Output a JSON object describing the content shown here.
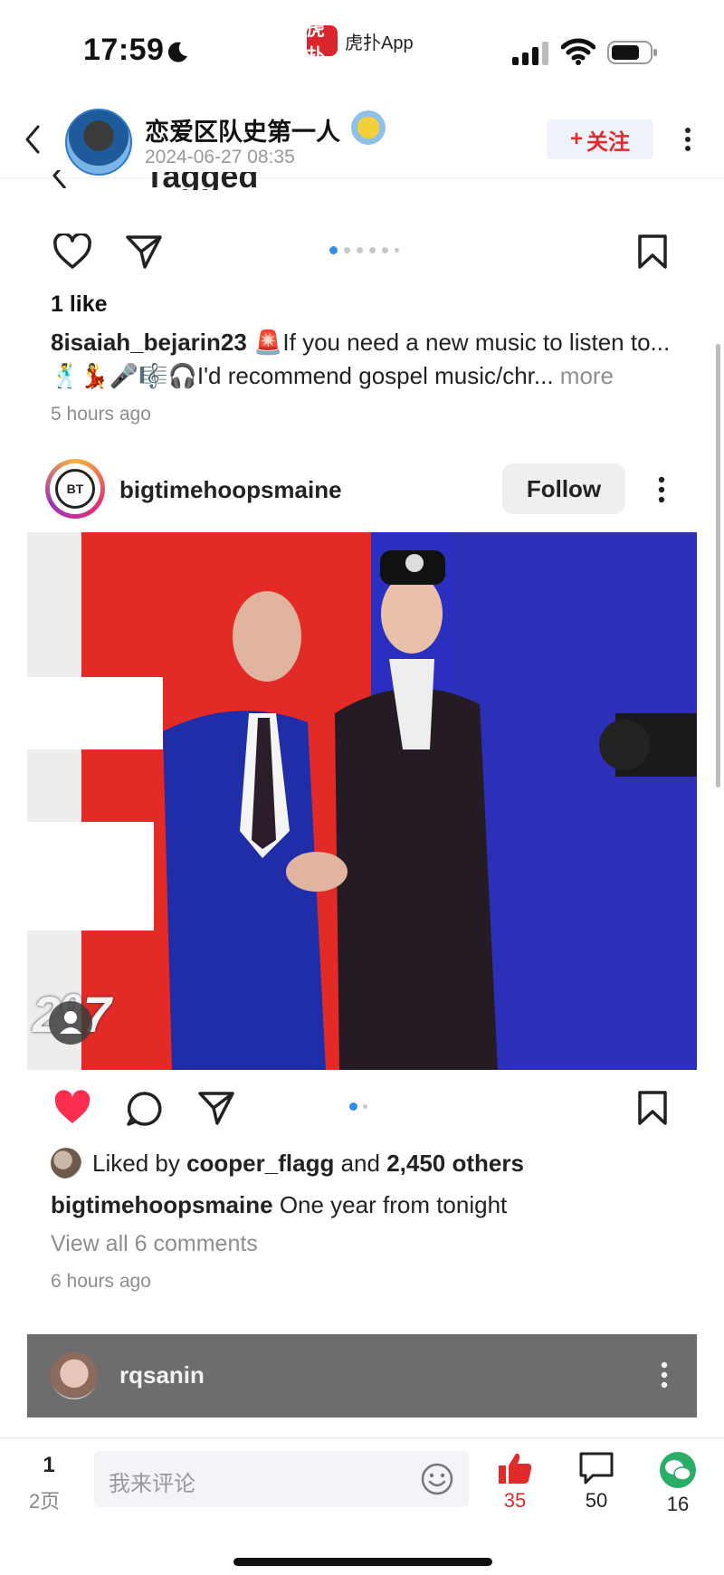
{
  "status_bar": {
    "time": "17:59",
    "app_name": "虎扑App",
    "app_logo_text": "虎扑"
  },
  "header": {
    "title": "恋爱区队史第一人",
    "date": "2024-06-27 08:35",
    "follow_label": "关注"
  },
  "embedded": {
    "tagged_title": "Tagged",
    "post1": {
      "likes": "1 like",
      "username": "8isaiah_bejarin23",
      "caption_text": "🚨If you need a new music to listen to...🕺💃🎤🎼🎧I'd recommend gospel music/chr...",
      "more_label": "more",
      "time": "5 hours ago"
    },
    "post2": {
      "username": "bigtimehoopsmaine",
      "avatar_text": "BT",
      "follow_label": "Follow",
      "photo_logo": "2⁰7",
      "liked_by_prefix": "Liked by",
      "liked_by_user": "cooper_flagg",
      "liked_by_and": "and",
      "liked_by_count": "2,450 others",
      "caption_user": "bigtimehoopsmaine",
      "caption_text": "One year from tonight",
      "view_comments": "View all 6 comments",
      "time": "6 hours ago"
    },
    "post3": {
      "username": "rqsanin"
    }
  },
  "bottom_bar": {
    "page_current": "1",
    "page_total": "2页",
    "comment_placeholder": "我来评论",
    "likes": "35",
    "comments": "50",
    "shares": "16"
  },
  "colors": {
    "accent_red": "#e02b2b",
    "instagram_blue": "#2f8fe6",
    "wechat_green": "#2aae67"
  }
}
